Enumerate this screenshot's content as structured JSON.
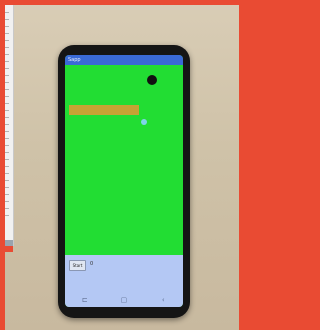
{
  "colors": {
    "frame": "#e94b33",
    "screen": "#22dd33",
    "status_bar": "#3a6ad6",
    "bottom_panel": "#b4c8f4",
    "orange_bar": "#c7a334",
    "black_dot": "#111111",
    "blue_dot": "#7fd4ea"
  },
  "status_bar": {
    "title": "Sapp"
  },
  "bottom_panel": {
    "button_label": "Start",
    "mark": "0"
  },
  "nav": {
    "recent_icon": "recent-apps-icon",
    "home_icon": "home-icon",
    "back_icon": "back-icon",
    "recent_glyph": "⊏",
    "home_glyph": "▢",
    "back_glyph": "‹"
  }
}
